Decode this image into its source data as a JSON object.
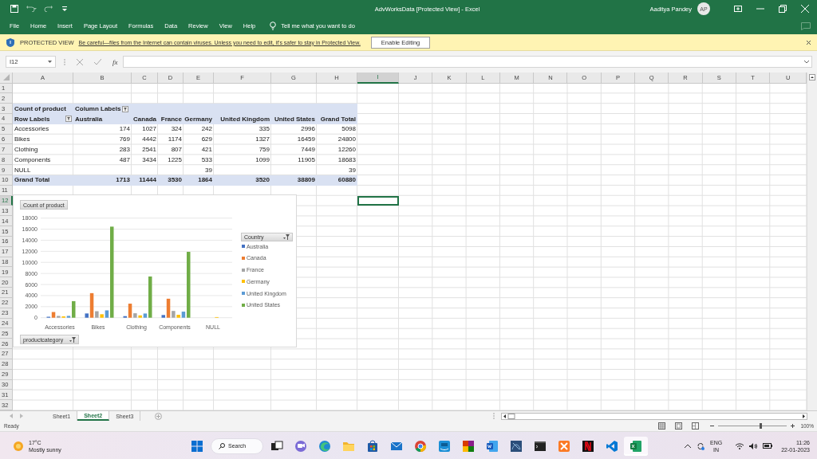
{
  "window": {
    "title": "AdvWorksData [Protected View] - Excel",
    "user": "Aaditya Pandey",
    "initials": "AP"
  },
  "ribbon": {
    "tabs": [
      "File",
      "Home",
      "Insert",
      "Page Layout",
      "Formulas",
      "Data",
      "Review",
      "View",
      "Help"
    ],
    "tell_me": "Tell me what you want to do"
  },
  "protected_view": {
    "label": "PROTECTED VIEW",
    "message": "Be careful—files from the Internet can contain viruses. Unless you need to edit, it's safer to stay in Protected View.",
    "button": "Enable Editing"
  },
  "formula_bar": {
    "name_box": "I12",
    "function_button": "fx"
  },
  "columns": [
    {
      "label": "A",
      "selected": false
    },
    {
      "label": "B",
      "selected": false
    },
    {
      "label": "C",
      "selected": false
    },
    {
      "label": "D",
      "selected": false
    },
    {
      "label": "E",
      "selected": false
    },
    {
      "label": "F",
      "selected": false
    },
    {
      "label": "G",
      "selected": false
    },
    {
      "label": "H",
      "selected": false
    },
    {
      "label": "I",
      "selected": true
    },
    {
      "label": "J",
      "selected": false
    },
    {
      "label": "K",
      "selected": false
    },
    {
      "label": "L",
      "selected": false
    },
    {
      "label": "M",
      "selected": false
    },
    {
      "label": "N",
      "selected": false
    },
    {
      "label": "O",
      "selected": false
    },
    {
      "label": "P",
      "selected": false
    },
    {
      "label": "Q",
      "selected": false
    },
    {
      "label": "R",
      "selected": false
    },
    {
      "label": "S",
      "selected": false
    },
    {
      "label": "T",
      "selected": false
    },
    {
      "label": "U",
      "selected": false
    }
  ],
  "rows": [
    {
      "label": "1",
      "selected": false
    },
    {
      "label": "2",
      "selected": false
    },
    {
      "label": "3",
      "selected": false
    },
    {
      "label": "4",
      "selected": false
    },
    {
      "label": "5",
      "selected": false
    },
    {
      "label": "6",
      "selected": false
    },
    {
      "label": "7",
      "selected": false
    },
    {
      "label": "8",
      "selected": false
    },
    {
      "label": "9",
      "selected": false
    },
    {
      "label": "10",
      "selected": false
    },
    {
      "label": "11",
      "selected": false
    },
    {
      "label": "12",
      "selected": true
    },
    {
      "label": "13",
      "selected": false
    },
    {
      "label": "14",
      "selected": false
    },
    {
      "label": "15",
      "selected": false
    },
    {
      "label": "16",
      "selected": false
    },
    {
      "label": "17",
      "selected": false
    },
    {
      "label": "18",
      "selected": false
    },
    {
      "label": "19",
      "selected": false
    },
    {
      "label": "20",
      "selected": false
    },
    {
      "label": "21",
      "selected": false
    },
    {
      "label": "22",
      "selected": false
    },
    {
      "label": "23",
      "selected": false
    },
    {
      "label": "24",
      "selected": false
    },
    {
      "label": "25",
      "selected": false
    },
    {
      "label": "26",
      "selected": false
    },
    {
      "label": "27",
      "selected": false
    },
    {
      "label": "28",
      "selected": false
    },
    {
      "label": "29",
      "selected": false
    },
    {
      "label": "30",
      "selected": false
    },
    {
      "label": "31",
      "selected": false
    },
    {
      "label": "32",
      "selected": false
    }
  ],
  "pivot_table": {
    "value_label": "Count of product",
    "column_labels": "Column Labels",
    "row_labels": "Row Labels",
    "columns": [
      "Australia",
      "Canada",
      "France",
      "Germany",
      "United Kingdom",
      "United States",
      "Grand Total"
    ],
    "rows": [
      {
        "label": "Accessories",
        "values": [
          "174",
          "1027",
          "324",
          "242",
          "335",
          "2996",
          "5098"
        ]
      },
      {
        "label": "Bikes",
        "values": [
          "769",
          "4442",
          "1174",
          "629",
          "1327",
          "16459",
          "24800"
        ]
      },
      {
        "label": "Clothing",
        "values": [
          "283",
          "2541",
          "807",
          "421",
          "759",
          "7449",
          "12260"
        ]
      },
      {
        "label": "Components",
        "values": [
          "487",
          "3434",
          "1225",
          "533",
          "1099",
          "11905",
          "18683"
        ]
      },
      {
        "label": "NULL",
        "values": {
          "3": "39",
          "6": "39"
        }
      }
    ],
    "total": {
      "label": "Grand Total",
      "values": [
        "1713",
        "11444",
        "3530",
        "1864",
        "3520",
        "38809",
        "60880"
      ]
    }
  },
  "chart": {
    "value_field": "Count of product",
    "legend_field": "Country",
    "axis_field": "productcategory",
    "chart_data": {
      "type": "bar",
      "categories": [
        "Accessories",
        "Bikes",
        "Clothing",
        "Components",
        "NULL"
      ],
      "ylim": [
        0,
        18000
      ],
      "grid": true,
      "legend": true,
      "yticks": [
        0,
        2000,
        4000,
        6000,
        8000,
        10000,
        12000,
        14000,
        16000,
        18000
      ],
      "stacked": false,
      "series": [
        {
          "name": "Australia",
          "color": "#4472c4",
          "values": [
            174,
            769,
            283,
            487,
            null
          ]
        },
        {
          "name": "Canada",
          "color": "#ed7d31",
          "values": [
            1027,
            4442,
            2541,
            3434,
            null
          ]
        },
        {
          "name": "France",
          "color": "#a5a5a5",
          "values": [
            324,
            1174,
            807,
            1225,
            null
          ]
        },
        {
          "name": "Germany",
          "color": "#ffc000",
          "values": [
            242,
            629,
            421,
            533,
            39
          ]
        },
        {
          "name": "United Kingdom",
          "color": "#5b9bd5",
          "values": [
            335,
            1327,
            759,
            1099,
            null
          ]
        },
        {
          "name": "United States",
          "color": "#70ad47",
          "values": [
            2996,
            16459,
            7449,
            11905,
            null
          ]
        }
      ]
    }
  },
  "sheet_tabs": [
    {
      "label": "Sheet1",
      "selected": false
    },
    {
      "label": "Sheet2",
      "selected": true
    },
    {
      "label": "Sheet3",
      "selected": false
    }
  ],
  "status_bar": {
    "status": "Ready",
    "zoom": "100%",
    "zoom_slider": {
      "level": 0.62
    }
  },
  "taskbar": {
    "temperature": "17°C",
    "weather": "Mostly sunny",
    "search": "Search",
    "language": "ENG",
    "region": "IN",
    "time": "11:26",
    "date": "22-01-2023"
  }
}
